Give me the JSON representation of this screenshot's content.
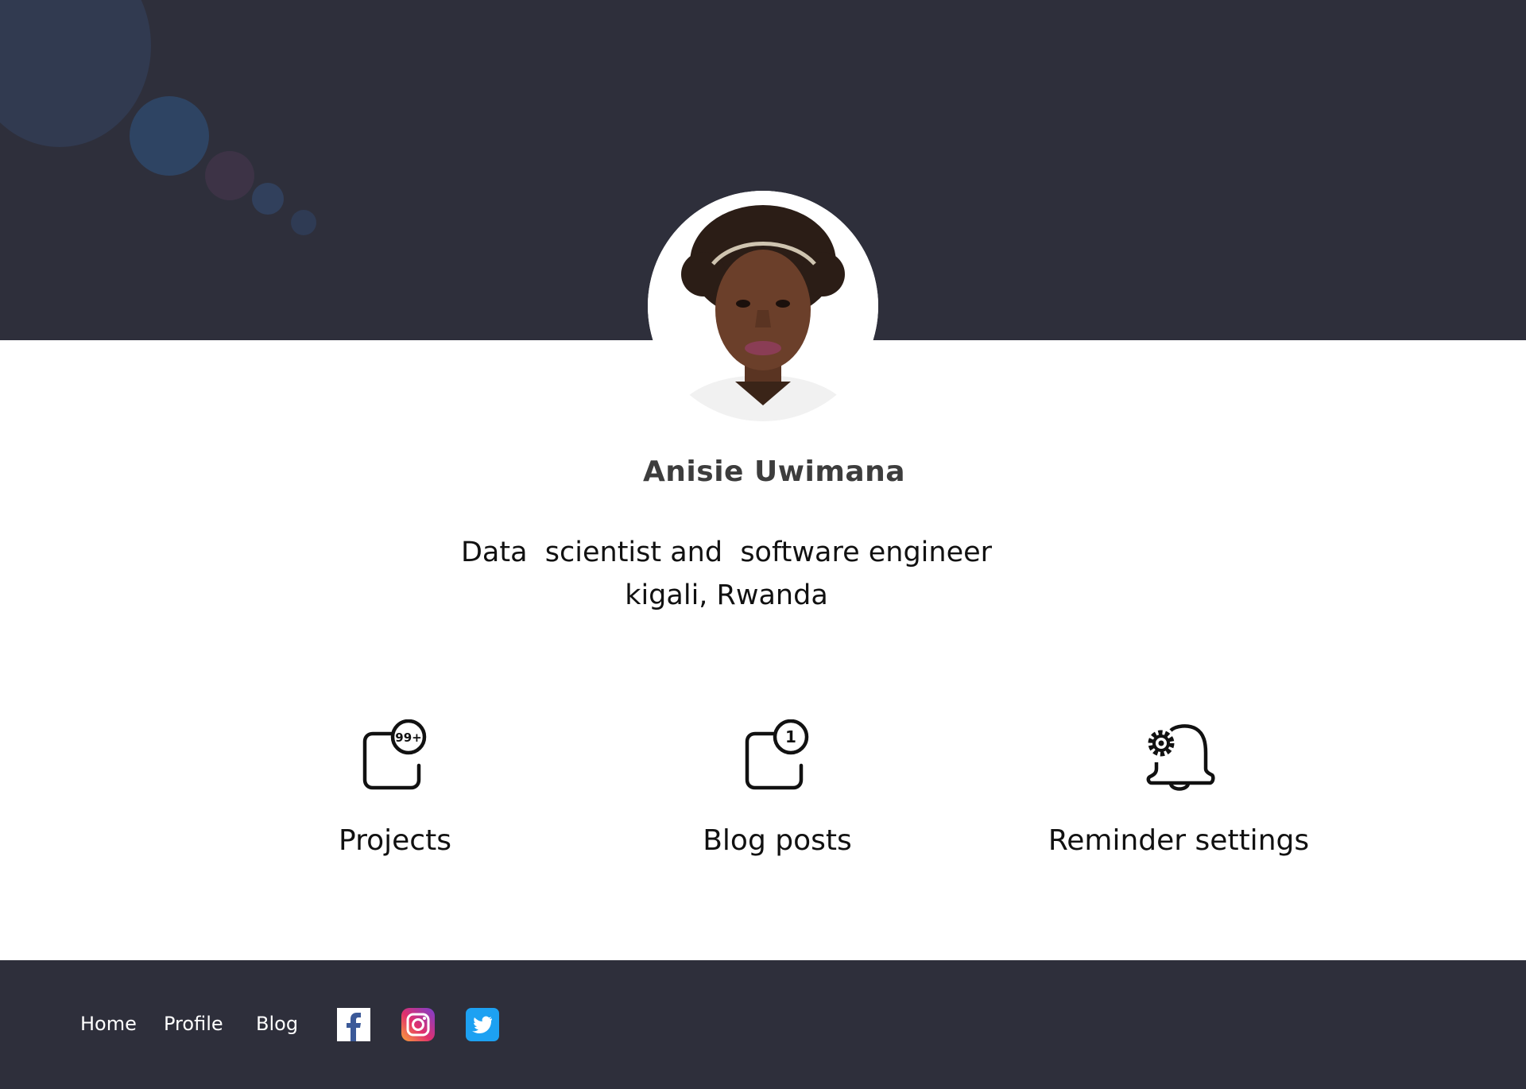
{
  "profile": {
    "name": "Anisie Uwimana",
    "title": "Data  scientist and  software engineer",
    "location": "kigali, Rwanda",
    "avatar_alt": "profile photo"
  },
  "features": [
    {
      "label": "Projects",
      "icon": "notification-square-icon",
      "badge": "99+"
    },
    {
      "label": "Blog posts",
      "icon": "notification-square-icon",
      "badge": "1"
    },
    {
      "label": "Reminder settings",
      "icon": "bell-settings-icon"
    }
  ],
  "footer": {
    "nav": [
      "Home",
      "Profile",
      "Blog"
    ],
    "social": [
      "facebook-icon",
      "instagram-icon",
      "twitter-icon"
    ]
  },
  "colors": {
    "header_bg": "#2e2f3b",
    "footer_bg": "#2e2f3b",
    "name_text": "#3d3d3d",
    "facebook": "#3b5998",
    "twitter": "#1da1f2"
  }
}
